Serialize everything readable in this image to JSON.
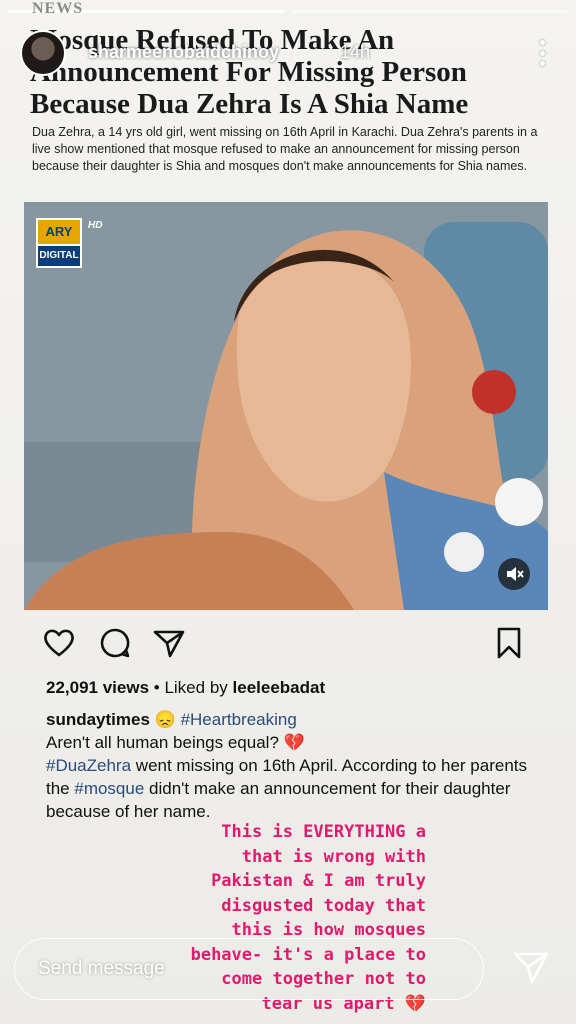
{
  "story": {
    "username": "sharmeenobaidchinoy",
    "time": "14h",
    "progress_total": 2,
    "progress_done": 1
  },
  "article": {
    "section": "NEWS",
    "headline": "Mosque Refused To Make An Announcement For Missing Person Because Dua Zehra Is A Shia Name",
    "body": "Dua Zehra, a 14 yrs old girl, went missing on 16th April in Karachi. Dua Zehra's parents in a live show mentioned that mosque refused to make an announcement for missing person because their daughter is Shia and mosques don't make announcements for Shia names.",
    "channel_logo_top": "ARY",
    "channel_logo_bottom": "DIGITAL",
    "channel_hd": "HD"
  },
  "post": {
    "views": "22,091 views",
    "liked_by_prefix": "Liked by",
    "liked_by": "leeleebadat",
    "caption_user": "sundaytimes",
    "caption_emoji": "😞",
    "caption_tag1": "#Heartbreaking",
    "caption_line2": "Aren't all human beings equal? 💔",
    "caption_tag2": "#DuaZehra",
    "caption_line3a": " went missing on 16th April. According to her parents the ",
    "caption_tag3": "#mosque",
    "caption_line3b": " didn't make an announcement for their daughter because of her name."
  },
  "overlay_text": "This is EVERYTHING a\nthat is wrong with\nPakistan & I am truly\ndisgusted today that\nthis is how mosques\nbehave- it's a place to\ncome together not to\ntear us apart 💔",
  "reply": {
    "placeholder": "Send message"
  },
  "colors": {
    "overlay": "#e11a6d",
    "hashtag": "#2a4b7c"
  }
}
